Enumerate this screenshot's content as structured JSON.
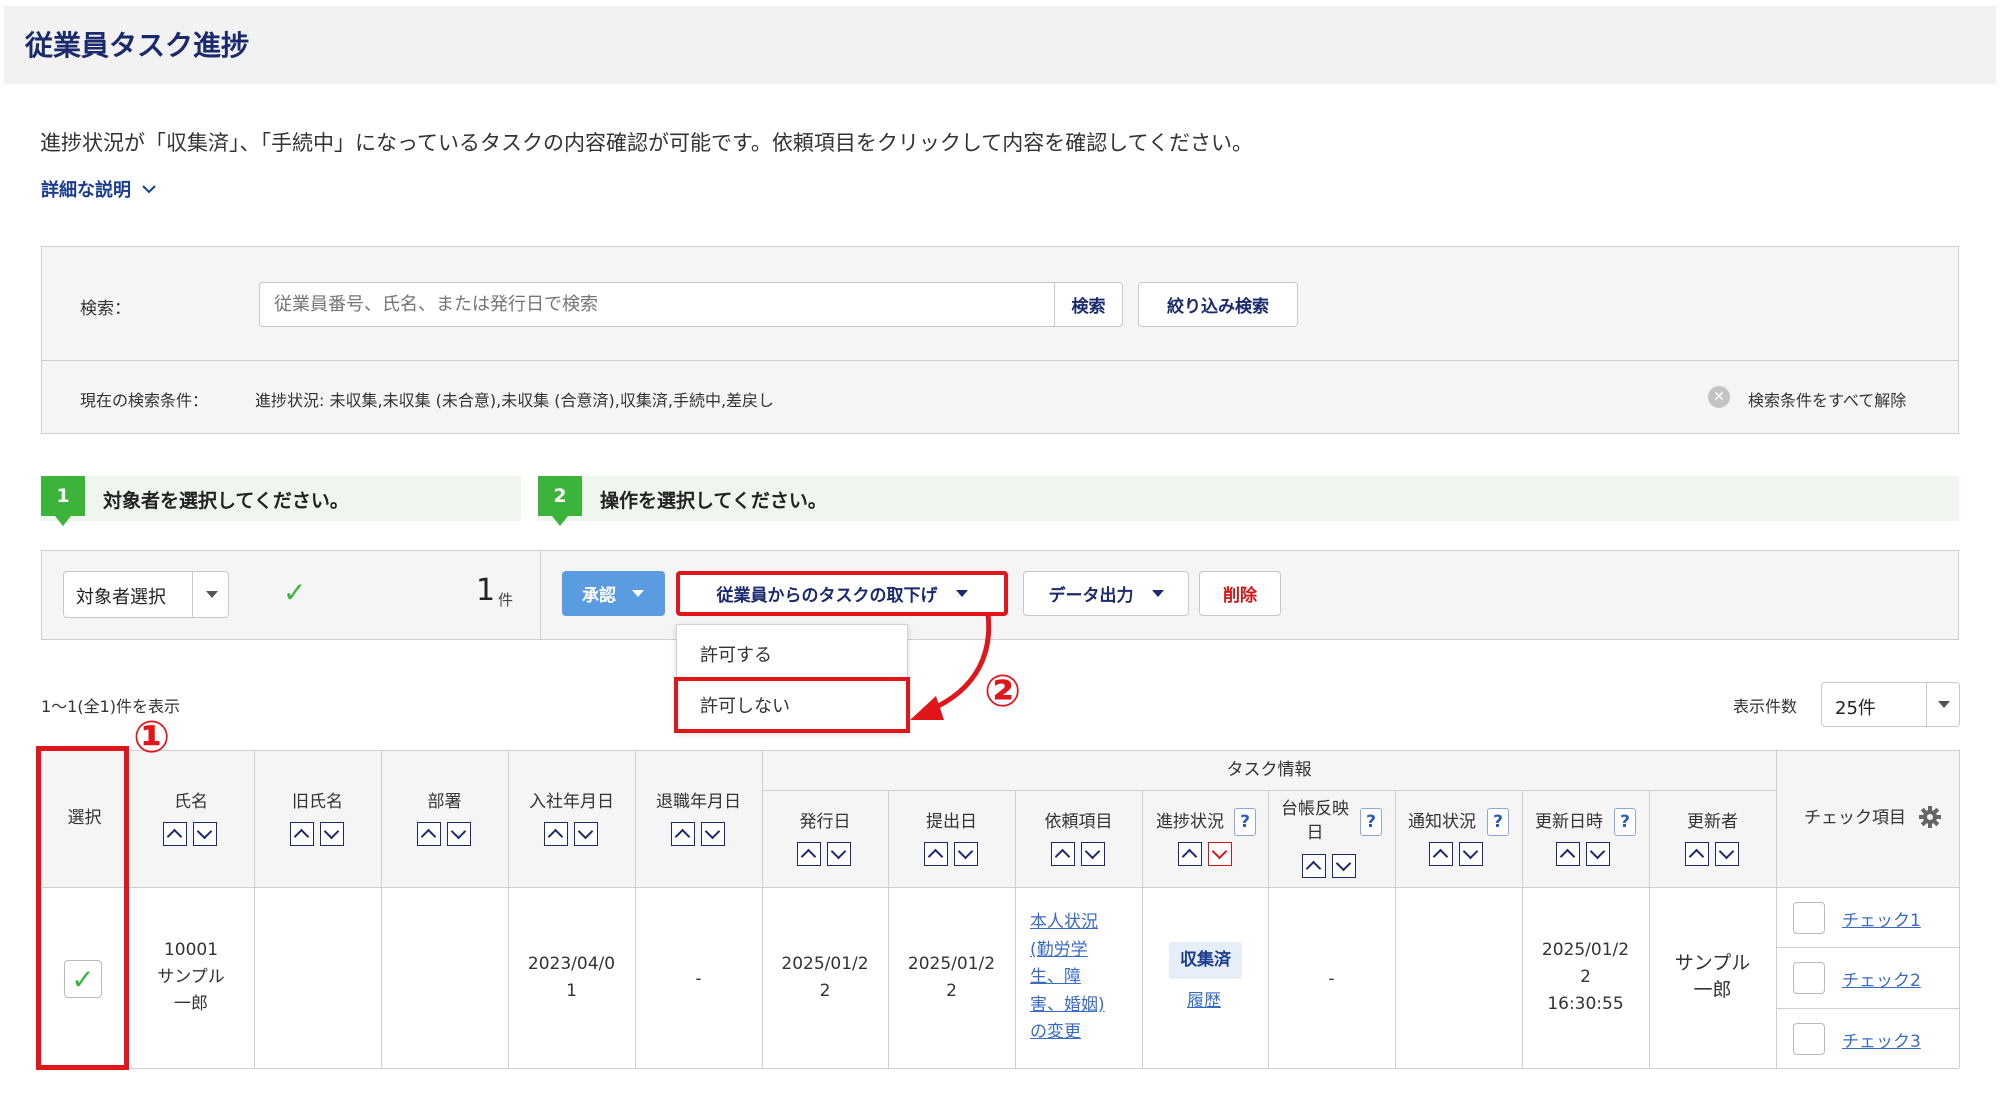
{
  "page": {
    "title": "従業員タスク進捗",
    "description": "進捗状況が「収集済」、「手続中」になっているタスクの内容確認が可能です。依頼項目をクリックして内容を確認してください。",
    "detail_link": "詳細な説明"
  },
  "search": {
    "label": "検索：",
    "placeholder": "従業員番号、氏名、または発行日で検索",
    "search_button": "検索",
    "filter_button": "絞り込み検索",
    "conditions_label": "現在の検索条件：",
    "conditions_value": "進捗状況: 未収集,未収集 (未合意),未収集 (合意済),収集済,手続中,差戻し",
    "clear_all": "検索条件をすべて解除"
  },
  "steps": [
    {
      "number": "1",
      "text": "対象者を選択してください。"
    },
    {
      "number": "2",
      "text": "操作を選択してください。"
    }
  ],
  "actions": {
    "target_select": "対象者選択",
    "selected_count": "1",
    "count_unit": "件",
    "approve": "承認",
    "withdraw": "従業員からのタスクの取下げ",
    "export": "データ出力",
    "delete": "削除",
    "dropdown": {
      "allow": "許可する",
      "deny": "許可しない"
    }
  },
  "annotations": {
    "one": "①",
    "two": "②"
  },
  "list": {
    "range_text": "1〜1(全1)件を表示",
    "per_page_label": "表示件数",
    "per_page_value": "25件"
  },
  "table": {
    "headers": {
      "select": "選択",
      "name": "氏名",
      "old_name": "旧氏名",
      "department": "部署",
      "join_date": "入社年月日",
      "leave_date": "退職年月日",
      "task_info": "タスク情報",
      "issue_date": "発行日",
      "submit_date": "提出日",
      "request_item": "依頼項目",
      "progress": "進捗状況",
      "ledger": "台帳反映日",
      "notify": "通知状況",
      "updated_at": "更新日時",
      "updated_by": "更新者",
      "check_items": "チェック項目"
    },
    "row": {
      "employee_no": "10001",
      "name_line1": "サンプル",
      "name_line2": "一郎",
      "join_line1": "2023/04/0",
      "join_line2": "1",
      "leave": "-",
      "issue_line1": "2025/01/2",
      "issue_line2": "2",
      "submit_line1": "2025/01/2",
      "submit_line2": "2",
      "req_1": "本人状況",
      "req_2": "(勤労学",
      "req_3": "生、障",
      "req_4": "害、婚姻)",
      "req_5": "の変更",
      "progress_badge": "収集済",
      "history": "履歴",
      "ledger": "-",
      "updated_line1": "2025/01/2",
      "updated_line2": "2",
      "updated_line3": "16:30:55",
      "by_line1": "サンプル",
      "by_line2": "一郎",
      "checks": [
        "チェック1",
        "チェック2",
        "チェック3"
      ]
    }
  },
  "colors": {
    "accent_red": "#e0161b",
    "step_green": "#3cb43c",
    "approve_blue": "#5b9be0",
    "title_navy": "#1a2a6c"
  }
}
